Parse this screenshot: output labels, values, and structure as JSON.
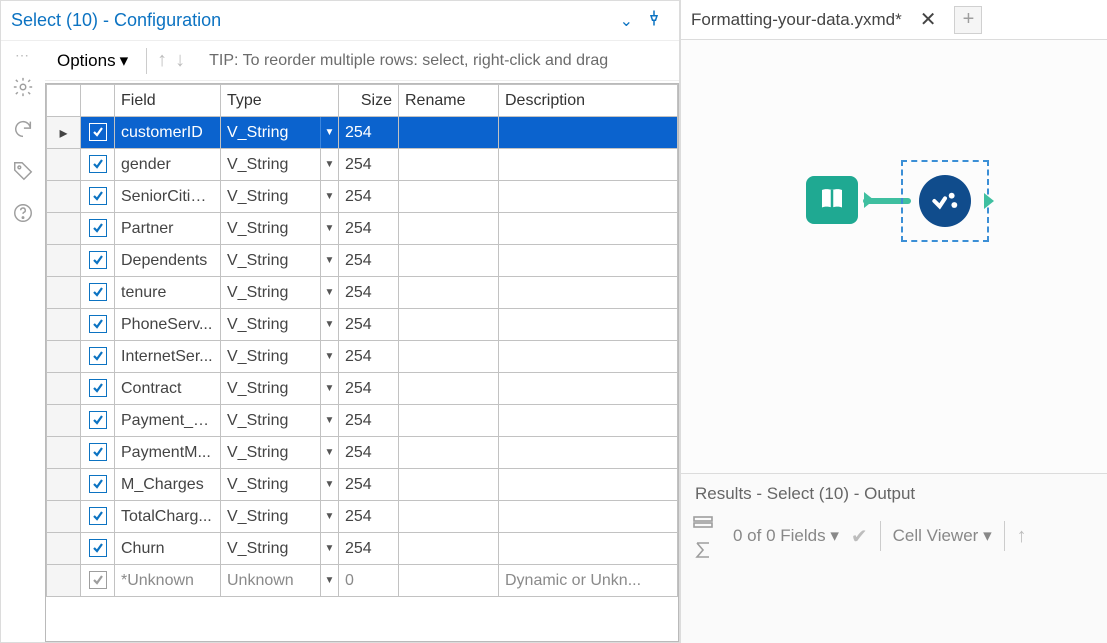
{
  "config": {
    "title": "Select (10) - Configuration",
    "options_label": "Options",
    "tip": "TIP: To reorder multiple rows: select, right-click and drag",
    "columns": {
      "field": "Field",
      "type": "Type",
      "size": "Size",
      "rename": "Rename",
      "description": "Description"
    },
    "rows": [
      {
        "checked": true,
        "field": "customerID",
        "type": "V_String",
        "size": "254",
        "rename": "",
        "description": "",
        "selected": true
      },
      {
        "checked": true,
        "field": "gender",
        "type": "V_String",
        "size": "254",
        "rename": "",
        "description": ""
      },
      {
        "checked": true,
        "field": "SeniorCitizen",
        "type": "V_String",
        "size": "254",
        "rename": "",
        "description": ""
      },
      {
        "checked": true,
        "field": "Partner",
        "type": "V_String",
        "size": "254",
        "rename": "",
        "description": ""
      },
      {
        "checked": true,
        "field": "Dependents",
        "type": "V_String",
        "size": "254",
        "rename": "",
        "description": ""
      },
      {
        "checked": true,
        "field": "tenure",
        "type": "V_String",
        "size": "254",
        "rename": "",
        "description": ""
      },
      {
        "checked": true,
        "field": "PhoneServ...",
        "type": "V_String",
        "size": "254",
        "rename": "",
        "description": ""
      },
      {
        "checked": true,
        "field": "InternetSer...",
        "type": "V_String",
        "size": "254",
        "rename": "",
        "description": ""
      },
      {
        "checked": true,
        "field": "Contract",
        "type": "V_String",
        "size": "254",
        "rename": "",
        "description": ""
      },
      {
        "checked": true,
        "field": "Payment_PB",
        "type": "V_String",
        "size": "254",
        "rename": "",
        "description": ""
      },
      {
        "checked": true,
        "field": "PaymentM...",
        "type": "V_String",
        "size": "254",
        "rename": "",
        "description": ""
      },
      {
        "checked": true,
        "field": "M_Charges",
        "type": "V_String",
        "size": "254",
        "rename": "",
        "description": ""
      },
      {
        "checked": true,
        "field": "TotalCharg...",
        "type": "V_String",
        "size": "254",
        "rename": "",
        "description": ""
      },
      {
        "checked": true,
        "field": "Churn",
        "type": "V_String",
        "size": "254",
        "rename": "",
        "description": ""
      },
      {
        "checked": true,
        "field": "*Unknown",
        "type": "Unknown",
        "size": "0",
        "rename": "",
        "description": "Dynamic or Unkn...",
        "unknown": true
      }
    ]
  },
  "document": {
    "tab_title": "Formatting-your-data.yxmd*"
  },
  "results": {
    "title": "Results - Select (10) - Output",
    "field_count": "0 of 0 Fields",
    "cell_viewer": "Cell Viewer"
  }
}
